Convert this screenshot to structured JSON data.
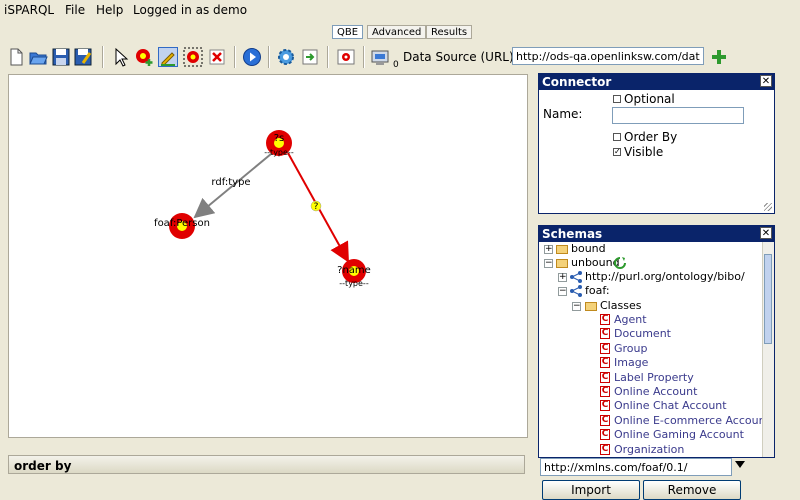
{
  "menu": [
    "iSPARQL",
    "File",
    "Help"
  ],
  "login_status": "Logged in as demo",
  "tabs": [
    "QBE",
    "Advanced",
    "Results"
  ],
  "toolbar": {
    "badge": "0",
    "data_source_label": "Data Source (URL):",
    "data_source_value": "http://ods-qa.openlinksw.com/datas",
    "icons": [
      "new-file-icon",
      "open-folder-icon",
      "save-icon",
      "save-as-icon",
      "pointer-icon",
      "add-node-icon",
      "edit-icon",
      "select-node-icon",
      "delete-icon",
      "run-icon",
      "settings-icon",
      "export-icon",
      "load-icon",
      "datasources-icon",
      "add-datasource-icon"
    ]
  },
  "graph": {
    "nodes": [
      {
        "top": "?s",
        "bottom": "--type--"
      },
      {
        "top": "foaf:Person",
        "bottom": ""
      },
      {
        "top": "?name",
        "bottom": "--type--"
      },
      {
        "top": "?",
        "bottom": ""
      }
    ],
    "edges": [
      "rdf:type",
      ""
    ]
  },
  "order_by_label": "order by",
  "connector": {
    "title": "Connector",
    "name_label": "Name:",
    "name_value": "",
    "optional_label": "Optional",
    "optional_checked": false,
    "order_by_label": "Order By",
    "order_by_checked": false,
    "visible_label": "Visible",
    "visible_checked": true,
    "close_glyph": "✕"
  },
  "schemas": {
    "title": "Schemas",
    "close_glyph": "✕",
    "tree": {
      "bound": "bound",
      "unbound": "unbound",
      "bibo": "http://purl.org/ontology/bibo/",
      "foaf": "foaf:",
      "classes": "Classes",
      "class_items": [
        "Agent",
        "Document",
        "Group",
        "Image",
        "Label Property",
        "Online Account",
        "Online Chat Account",
        "Online E-commerce Account",
        "Online Gaming Account",
        "Organization"
      ]
    },
    "url_value": "http://xmlns.com/foaf/0.1/",
    "import_label": "Import",
    "remove_label": "Remove"
  },
  "colors": {
    "node_red": "#e00000",
    "node_yellow": "#ffff00",
    "edge_red": "#e00000",
    "edge_gray": "#808080",
    "title_bar": "#0a246a",
    "add_green": "#2e9a2e"
  }
}
